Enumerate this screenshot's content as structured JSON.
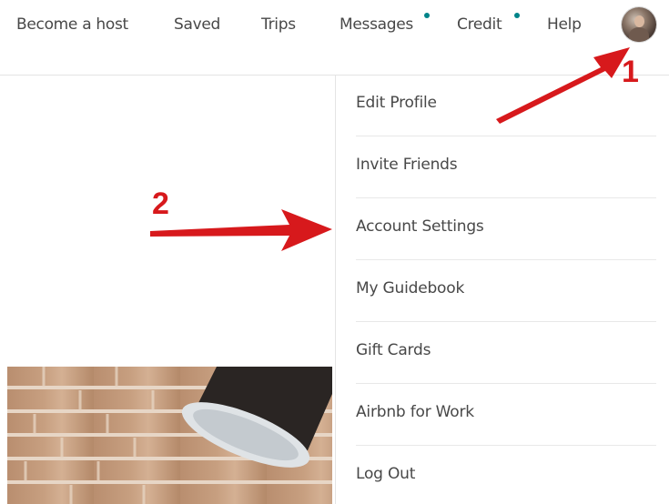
{
  "nav": {
    "items": [
      {
        "label": "Become a host"
      },
      {
        "label": "Saved"
      },
      {
        "label": "Trips"
      },
      {
        "label": "Messages",
        "has_dot": true
      },
      {
        "label": "Credit",
        "has_dot": true
      },
      {
        "label": "Help"
      }
    ],
    "avatar_icon": "user-avatar",
    "dot_color": "#008489"
  },
  "menu": {
    "items": [
      {
        "label": "Edit Profile"
      },
      {
        "label": "Invite Friends"
      },
      {
        "label": "Account Settings"
      },
      {
        "label": "My Guidebook"
      },
      {
        "label": "Gift Cards"
      },
      {
        "label": "Airbnb for Work"
      },
      {
        "label": "Log Out"
      }
    ]
  },
  "annotations": {
    "step1": "1",
    "step2": "2",
    "color": "#d7191c"
  }
}
